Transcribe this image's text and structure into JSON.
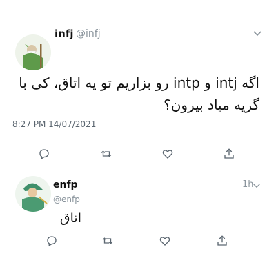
{
  "tweet": {
    "author_name": "infj",
    "author_handle": "@infj",
    "text_line1": "اگه intj و intp رو بزاریم تو یه اتاق، کی با",
    "text_line2": "گریه میاد بیرون؟",
    "timestamp": "8:27 PM 14/07/2021",
    "actions": [
      "reply-icon",
      "retweet-icon",
      "like-icon",
      "share-icon"
    ]
  },
  "reply": {
    "author_name": "enfp",
    "author_handle": "@enfp",
    "time": "1h",
    "text": "اتاق",
    "actions": [
      "reply-icon",
      "retweet-icon",
      "like-icon",
      "share-icon"
    ]
  },
  "colors": {
    "text": "#0f1419",
    "muted": "#8a949c",
    "divider": "#e6ecf0"
  }
}
